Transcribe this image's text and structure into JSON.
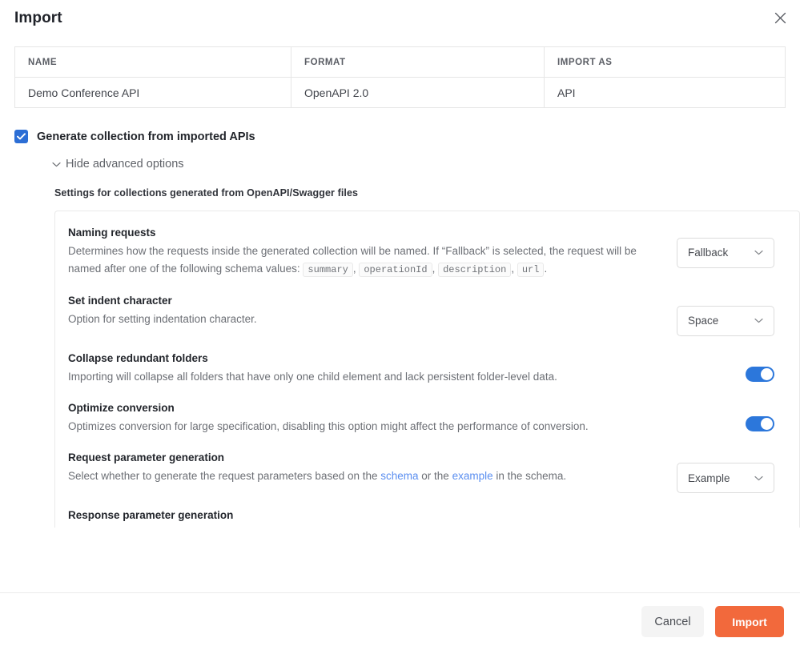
{
  "dialog": {
    "title": "Import",
    "close_icon": "close-icon"
  },
  "import_table": {
    "columns": [
      "NAME",
      "FORMAT",
      "IMPORT AS"
    ],
    "rows": [
      {
        "name": "Demo Conference API",
        "format": "OpenAPI 2.0",
        "import_as": "API"
      }
    ]
  },
  "generate_collection": {
    "label": "Generate collection from imported APIs",
    "checked": true
  },
  "advanced": {
    "toggle_label": "Hide advanced options",
    "chevron_icon": "chevron-down-icon",
    "settings_heading": "Settings for collections generated from OpenAPI/Swagger files"
  },
  "settings": [
    {
      "title": "Naming requests",
      "desc_parts": [
        {
          "type": "text",
          "value": "Determines how the requests inside the generated collection will be named. If “Fallback” is selected, the request will be named after one of the following schema values: "
        },
        {
          "type": "code",
          "value": "summary"
        },
        {
          "type": "text",
          "value": ", "
        },
        {
          "type": "code",
          "value": "operationId"
        },
        {
          "type": "text",
          "value": ", "
        },
        {
          "type": "code",
          "value": "description"
        },
        {
          "type": "text",
          "value": ", "
        },
        {
          "type": "code",
          "value": "url"
        },
        {
          "type": "text",
          "value": "."
        }
      ],
      "control": {
        "kind": "dropdown",
        "value": "Fallback",
        "icon": "chevron-down-icon"
      }
    },
    {
      "title": "Set indent character",
      "desc_parts": [
        {
          "type": "text",
          "value": "Option for setting indentation character."
        }
      ],
      "control": {
        "kind": "dropdown",
        "value": "Space",
        "icon": "chevron-down-icon"
      }
    },
    {
      "title": "Collapse redundant folders",
      "desc_parts": [
        {
          "type": "text",
          "value": "Importing will collapse all folders that have only one child element and lack persistent folder-level data."
        }
      ],
      "control": {
        "kind": "switch",
        "on": true
      }
    },
    {
      "title": "Optimize conversion",
      "desc_parts": [
        {
          "type": "text",
          "value": "Optimizes conversion for large specification, disabling this option might affect the performance of conversion."
        }
      ],
      "control": {
        "kind": "switch",
        "on": true
      }
    },
    {
      "title": "Request parameter generation",
      "desc_parts": [
        {
          "type": "text",
          "value": "Select whether to generate the request parameters based on the "
        },
        {
          "type": "link",
          "value": "schema"
        },
        {
          "type": "text",
          "value": " or the "
        },
        {
          "type": "link",
          "value": "example"
        },
        {
          "type": "text",
          "value": " in the schema."
        }
      ],
      "control": {
        "kind": "dropdown",
        "value": "Example",
        "icon": "chevron-down-icon"
      }
    },
    {
      "title": "Response parameter generation",
      "desc_parts": [],
      "control": {
        "kind": "none"
      }
    }
  ],
  "footer": {
    "cancel_label": "Cancel",
    "import_label": "Import"
  },
  "colors": {
    "accent_primary": "#f2693c",
    "toggle_on": "#2c77db",
    "checkbox": "#2c6ed5",
    "link": "#5a8ef0"
  }
}
